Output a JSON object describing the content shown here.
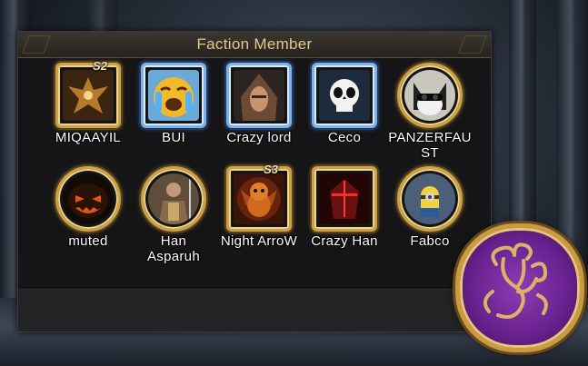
{
  "panel": {
    "title": "Faction Member"
  },
  "members": [
    {
      "name": "MIQAAYIL",
      "badge": "S2",
      "frame": "gold",
      "avatar_icon": "phoenix-icon",
      "color": "#b57a2c"
    },
    {
      "name": "BUI",
      "badge": "",
      "frame": "blue",
      "avatar_icon": "crying-emoji-icon",
      "color": "#f2b928"
    },
    {
      "name": "Crazy lord",
      "badge": "",
      "frame": "blue",
      "avatar_icon": "hooded-assassin-icon",
      "color": "#6b4a36"
    },
    {
      "name": "Ceco",
      "badge": "",
      "frame": "blue",
      "avatar_icon": "skull-icon",
      "color": "#1d2b3c"
    },
    {
      "name": "PANZERFAUST",
      "badge": "",
      "frame": "gold",
      "avatar_icon": "cat-icon",
      "color": "#8b8f96"
    },
    {
      "name": "muted",
      "badge": "",
      "frame": "gold",
      "avatar_icon": "jack-o-lantern-icon",
      "color": "#e0561a"
    },
    {
      "name": "Han Asparuh",
      "badge": "",
      "frame": "gold",
      "avatar_icon": "knight-icon",
      "color": "#8a6a4a"
    },
    {
      "name": "Night ArroW",
      "badge": "S3",
      "frame": "gold",
      "avatar_icon": "dragon-icon",
      "color": "#d26a1e"
    },
    {
      "name": "Crazy Han",
      "badge": "",
      "frame": "gold",
      "avatar_icon": "red-mask-icon",
      "color": "#6a1010"
    },
    {
      "name": "Fabco",
      "badge": "",
      "frame": "gold",
      "avatar_icon": "minion-icon",
      "color": "#4d5f78"
    }
  ],
  "faction_emblem": {
    "icon": "three-headed-dragon-icon",
    "color": "#7a2aa0"
  }
}
